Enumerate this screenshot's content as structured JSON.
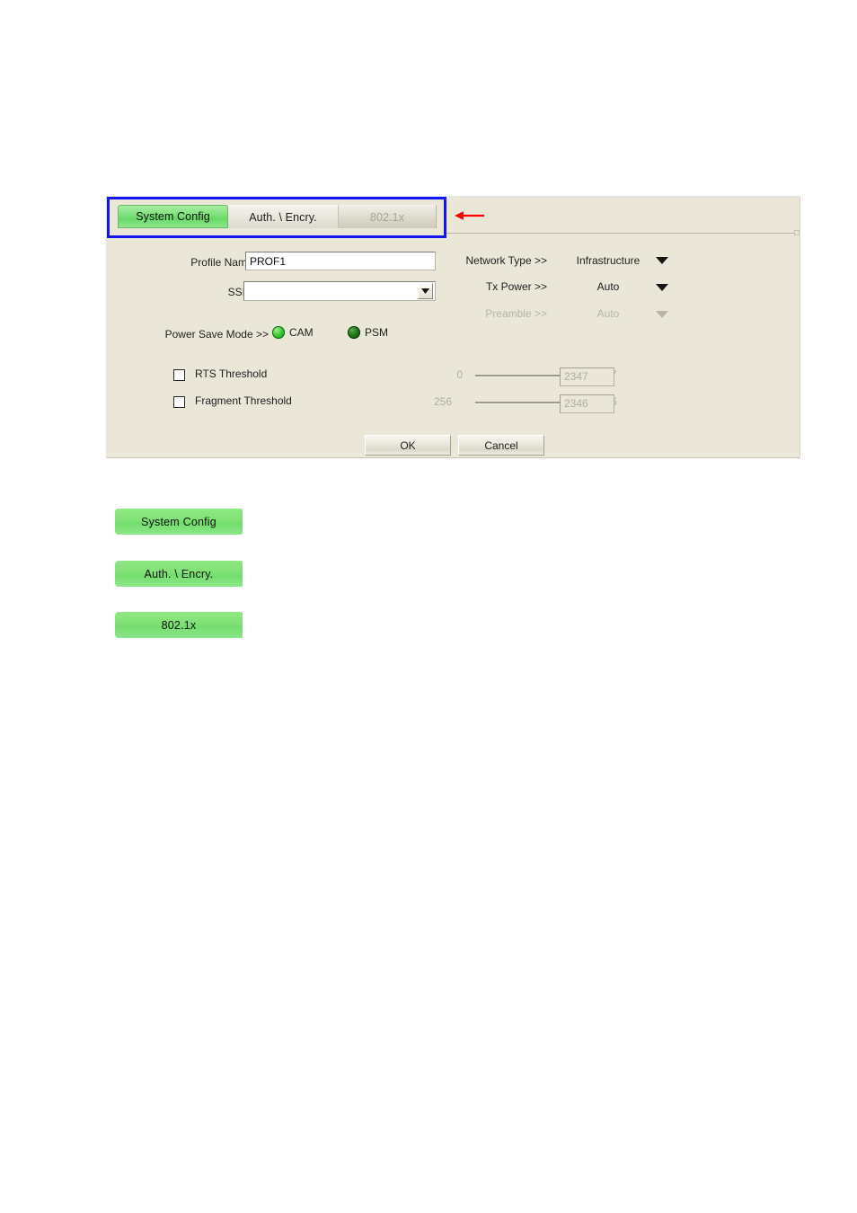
{
  "dialog": {
    "tabs": [
      {
        "id": "system-config",
        "label": "System Config",
        "state": "active"
      },
      {
        "id": "auth-encry",
        "label": "Auth. \\ Encry.",
        "state": "normal"
      },
      {
        "id": "8021x",
        "label": "802.1x",
        "state": "disabled"
      }
    ],
    "annotation": {
      "icon": "left-arrow-icon",
      "color": "#ff0000"
    },
    "highlight_color": "#1414f0",
    "form": {
      "profile_name": {
        "label": "Profile Name >>",
        "value": "PROF1",
        "placeholder": ""
      },
      "ssid": {
        "label": "SSID >>",
        "value": "",
        "placeholder": "",
        "icon": "chevron-down-icon"
      },
      "power_save_mode": {
        "label": "Power Save Mode >>",
        "options": [
          {
            "label": "CAM",
            "selected": false
          },
          {
            "label": "PSM",
            "selected": true
          }
        ]
      },
      "rts_threshold": {
        "label": "RTS Threshold",
        "checked": false,
        "min": "0",
        "max": "2347",
        "value": "2347",
        "slider_position_pct": 100
      },
      "fragment_threshold": {
        "label": "Fragment Threshold",
        "checked": false,
        "min": "256",
        "max": "2346",
        "value": "2346",
        "slider_position_pct": 100
      },
      "network_type": {
        "label": "Network Type >>",
        "value": "Infrastructure",
        "enabled": true,
        "icon": "chevron-down-icon"
      },
      "tx_power": {
        "label": "Tx Power >>",
        "value": "Auto",
        "enabled": true,
        "icon": "chevron-down-icon"
      },
      "preamble": {
        "label": "Preamble >>",
        "value": "Auto",
        "enabled": false,
        "icon": "chevron-down-icon"
      }
    },
    "buttons": {
      "ok": "OK",
      "cancel": "Cancel"
    }
  },
  "legend_chips": [
    {
      "id": "system-config",
      "label": "System Config"
    },
    {
      "id": "auth-encry",
      "label": "Auth. \\ Encry."
    },
    {
      "id": "8021x",
      "label": "802.1x"
    }
  ],
  "colors": {
    "dialog_background": "#eae7d8",
    "page_background": "#ffffff",
    "active_tab_green": "#7ce07a",
    "chip_green": "#7ee173",
    "highlight_blue": "#1414f0",
    "annotation_red": "#ff0000",
    "disabled_text": "#b4b1a3"
  }
}
